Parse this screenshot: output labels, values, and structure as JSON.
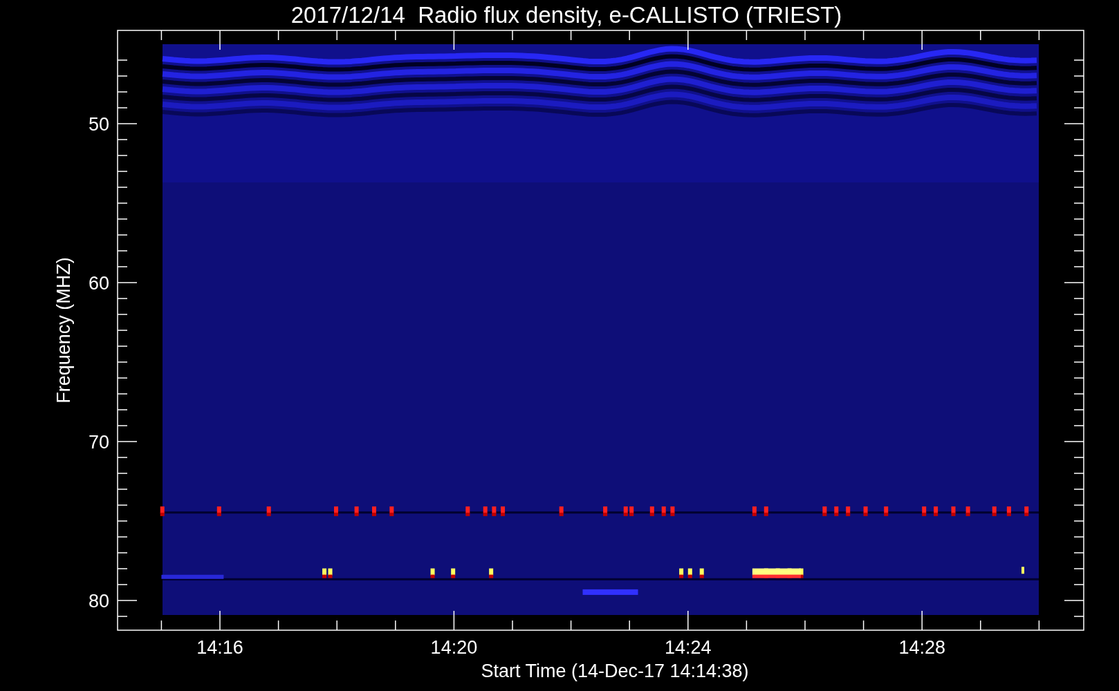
{
  "plot": {
    "title": "2017/12/14  Radio flux density, e-CALLISTO (TRIEST)",
    "ylabel": "Frequency (MHZ)",
    "yticks": [
      "50",
      "60",
      "70",
      "80"
    ],
    "xlabel": "Start Time (14-Dec-17 14:14:38)",
    "xticks": [
      "14:16",
      "14:20",
      "14:24",
      "14:28"
    ]
  }
}
